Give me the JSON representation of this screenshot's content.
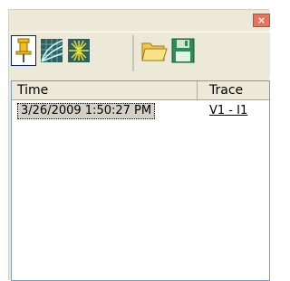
{
  "window": {
    "close_label": "×"
  },
  "toolbar": {
    "buttons": [
      {
        "icon": "pushpin-icon",
        "active": true
      },
      {
        "icon": "curve-plot-icon",
        "active": false
      },
      {
        "icon": "starburst-icon",
        "active": false
      },
      {
        "icon": "open-folder-icon",
        "active": false
      },
      {
        "icon": "save-disk-icon",
        "active": false
      }
    ]
  },
  "list": {
    "columns": [
      "Time",
      "Trace"
    ],
    "rows": [
      {
        "time": "3/26/2009 1:50:27 PM",
        "trace": "V1 - I1"
      }
    ]
  },
  "colors": {
    "close": "#e8735a",
    "pin": "#f0c020",
    "folder": "#f5c84a",
    "disk": "#2e8b57"
  }
}
